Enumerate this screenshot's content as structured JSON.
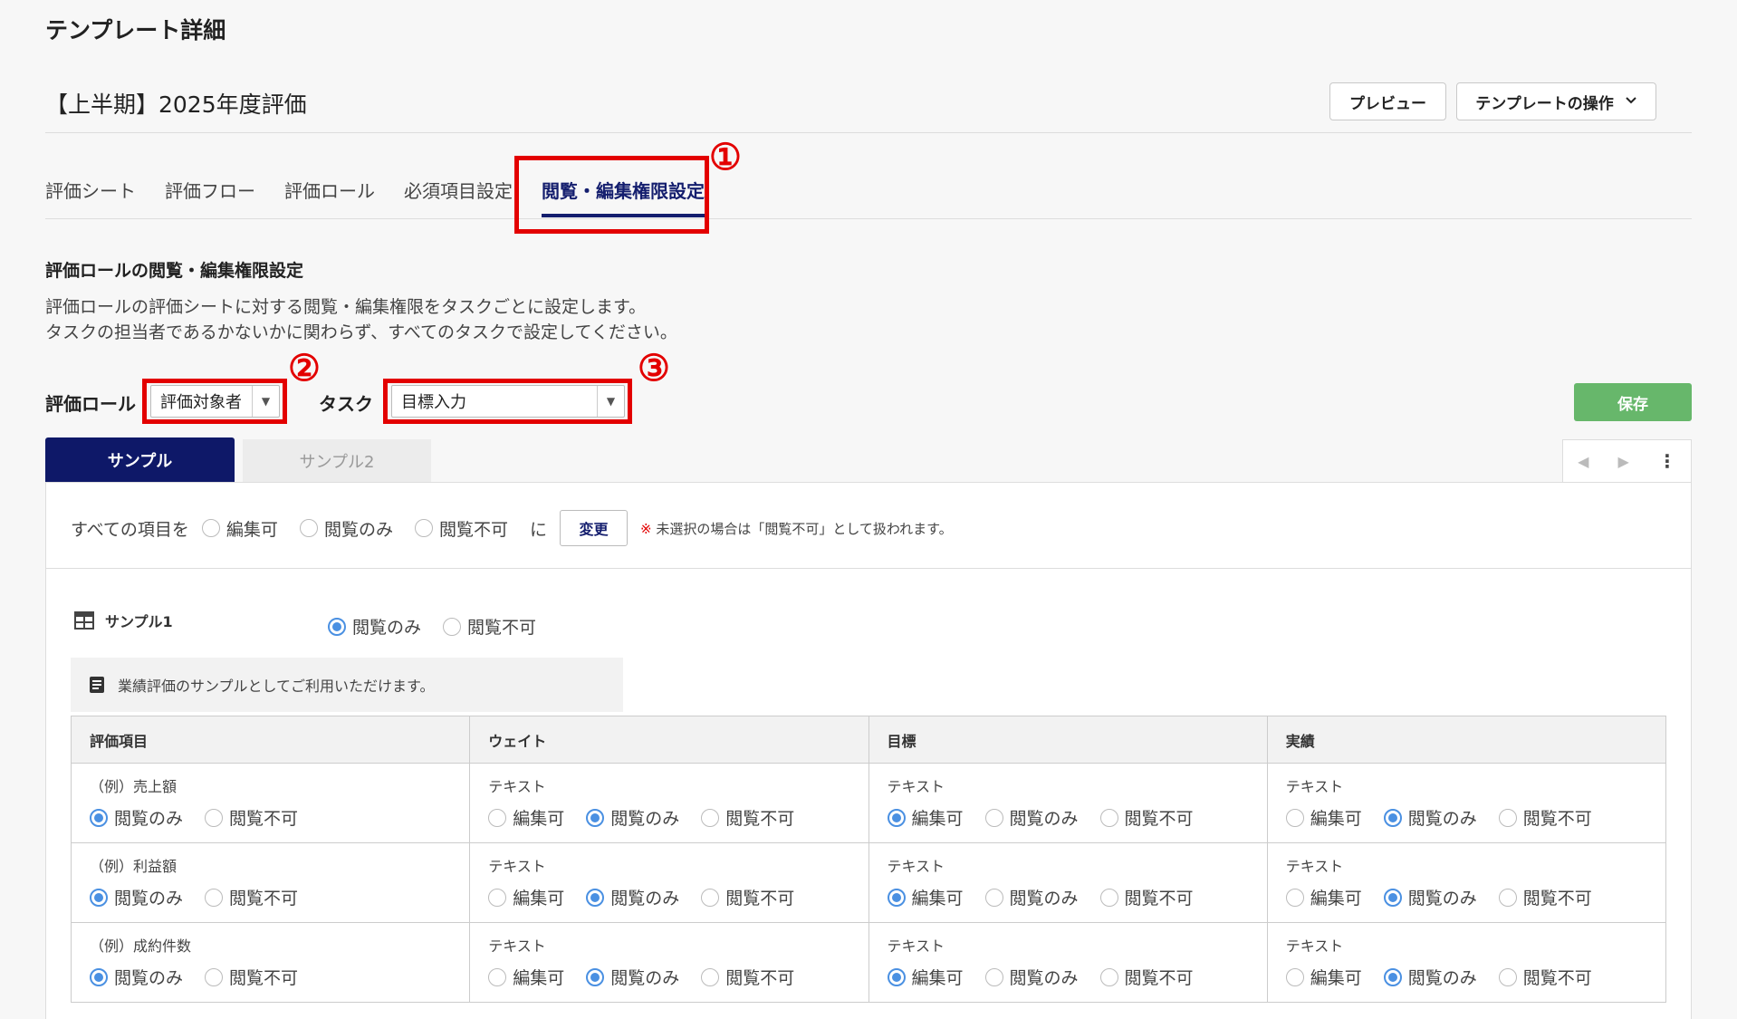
{
  "page": {
    "title": "テンプレート詳細",
    "template_name": "【上半期】2025年度評価"
  },
  "header": {
    "preview_label": "プレビュー",
    "operations_label": "テンプレートの操作"
  },
  "tabs": [
    {
      "label": "評価シート",
      "active": false
    },
    {
      "label": "評価フロー",
      "active": false
    },
    {
      "label": "評価ロール",
      "active": false
    },
    {
      "label": "必須項目設定",
      "active": false
    },
    {
      "label": "閲覧・編集権限設定",
      "active": true
    }
  ],
  "annotations": [
    "①",
    "②",
    "③"
  ],
  "section": {
    "title": "評価ロールの閲覧・編集権限設定",
    "desc_line1": "評価ロールの評価シートに対する閲覧・編集権限をタスクごとに設定します。",
    "desc_line2": "タスクの担当者であるかないかに関わらず、すべてのタスクで設定してください。"
  },
  "filters": {
    "role_label": "評価ロール",
    "role_value": "評価対象者",
    "task_label": "タスク",
    "task_value": "目標入力"
  },
  "save_label": "保存",
  "sheet_tabs": [
    "サンプル",
    "サンプル2"
  ],
  "bulk": {
    "prefix": "すべての項目を",
    "options": [
      "編集可",
      "閲覧のみ",
      "閲覧不可"
    ],
    "suffix": "に",
    "change_label": "変更",
    "note_mark": "※",
    "note": "未選択の場合は「閲覧不可」として扱われます。"
  },
  "sample1": {
    "name": "サンプル1",
    "options": [
      "閲覧のみ",
      "閲覧不可"
    ],
    "selected": 0,
    "info": "業績評価のサンプルとしてご利用いただけます。"
  },
  "grid": {
    "headers": [
      "評価項目",
      "ウェイト",
      "目標",
      "実績"
    ],
    "rows": [
      {
        "item": "（例）売上額",
        "weight": "テキスト",
        "goal": "テキスト",
        "result": "テキスト"
      },
      {
        "item": "（例）利益額",
        "weight": "テキスト",
        "goal": "テキスト",
        "result": "テキスト"
      },
      {
        "item": "（例）成約件数",
        "weight": "テキスト",
        "goal": "テキスト",
        "result": "テキスト"
      }
    ],
    "opt_view": "閲覧のみ",
    "opt_noview": "閲覧不可",
    "opt_edit": "編集可"
  },
  "icons": {
    "chevron": "chevron-down-icon",
    "select_arrow": "caret-down-icon",
    "table": "table-icon",
    "info": "document-icon",
    "nav_prev": "triangle-left-icon",
    "nav_next": "triangle-right-icon",
    "more": "more-vertical-icon"
  },
  "colors": {
    "accent": "#141e6e",
    "annotation": "#e30000",
    "save": "#67b76b",
    "radio_selected": "#4a90e2"
  }
}
